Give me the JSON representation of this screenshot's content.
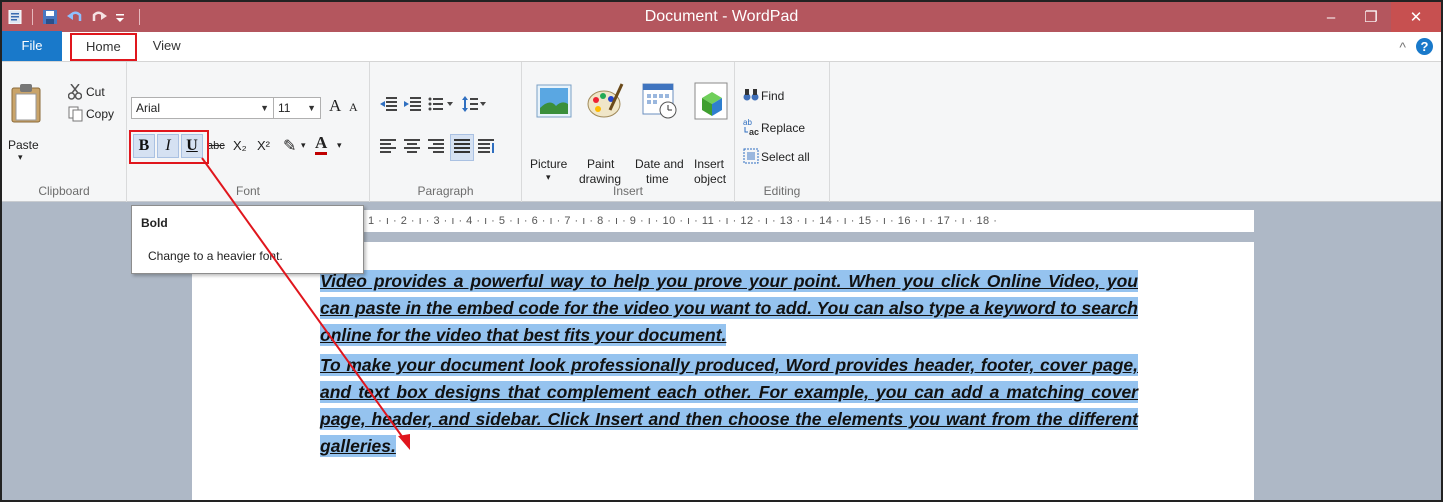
{
  "window": {
    "title": "Document - WordPad",
    "min_glyph": "–",
    "restore_glyph": "❐",
    "close_glyph": "✕"
  },
  "tabs": {
    "file": "File",
    "home": "Home",
    "view": "View"
  },
  "help": {
    "collapse_glyph": "^",
    "help_glyph": "?"
  },
  "clipboard": {
    "paste": "Paste",
    "paste_arrow": "▾",
    "cut": "Cut",
    "copy": "Copy",
    "label": "Clipboard"
  },
  "font": {
    "family": "Arial",
    "size": "11",
    "grow": "A",
    "shrink": "A",
    "bold": "B",
    "italic": "I",
    "underline": "U",
    "strike": "abc",
    "sub": "X₂",
    "sup": "X²",
    "highlight": "✎",
    "color": "A",
    "label": "Font"
  },
  "paragraph": {
    "label": "Paragraph"
  },
  "insert": {
    "picture": "Picture",
    "picture_arrow": "▾",
    "paint1": "Paint",
    "paint2": "drawing",
    "date1": "Date and",
    "date2": "time",
    "obj1": "Insert",
    "obj2": "object",
    "label": "Insert"
  },
  "editing": {
    "find": "Find",
    "replace": "Replace",
    "select_all": "Select all",
    "label": "Editing"
  },
  "ruler": {
    "text": "1 · ı · 2 · ı · 3 · ı · 4 · ı · 5 · ı · 6 · ı · 7 · ı · 8 · ı · 9 · ı · 10 · ı · 11 · ı · 12 · ı · 13 · ı · 14 · ı · 15 · ı · 16 · ı · 17 · ı · 18 ·"
  },
  "tooltip": {
    "title": "Bold",
    "body": "Change to a heavier font."
  },
  "document": {
    "p1": "Video provides a powerful way to help you prove your point. When you click Online Video, you can paste in the embed code for the video you want to add. You can also type a keyword to search online for the video that best fits your document.",
    "p2": "To make your document look professionally produced, Word provides header, footer, cover page, and text box designs that complement each other. For example, you can add a matching cover page, header, and sidebar. Click Insert and then choose the elements you want from the different galleries."
  },
  "colors": {
    "titlebar": "#b4565e",
    "file_tab": "#1979ca",
    "selection": "#95c3ef",
    "annotation": "#e0161d"
  }
}
